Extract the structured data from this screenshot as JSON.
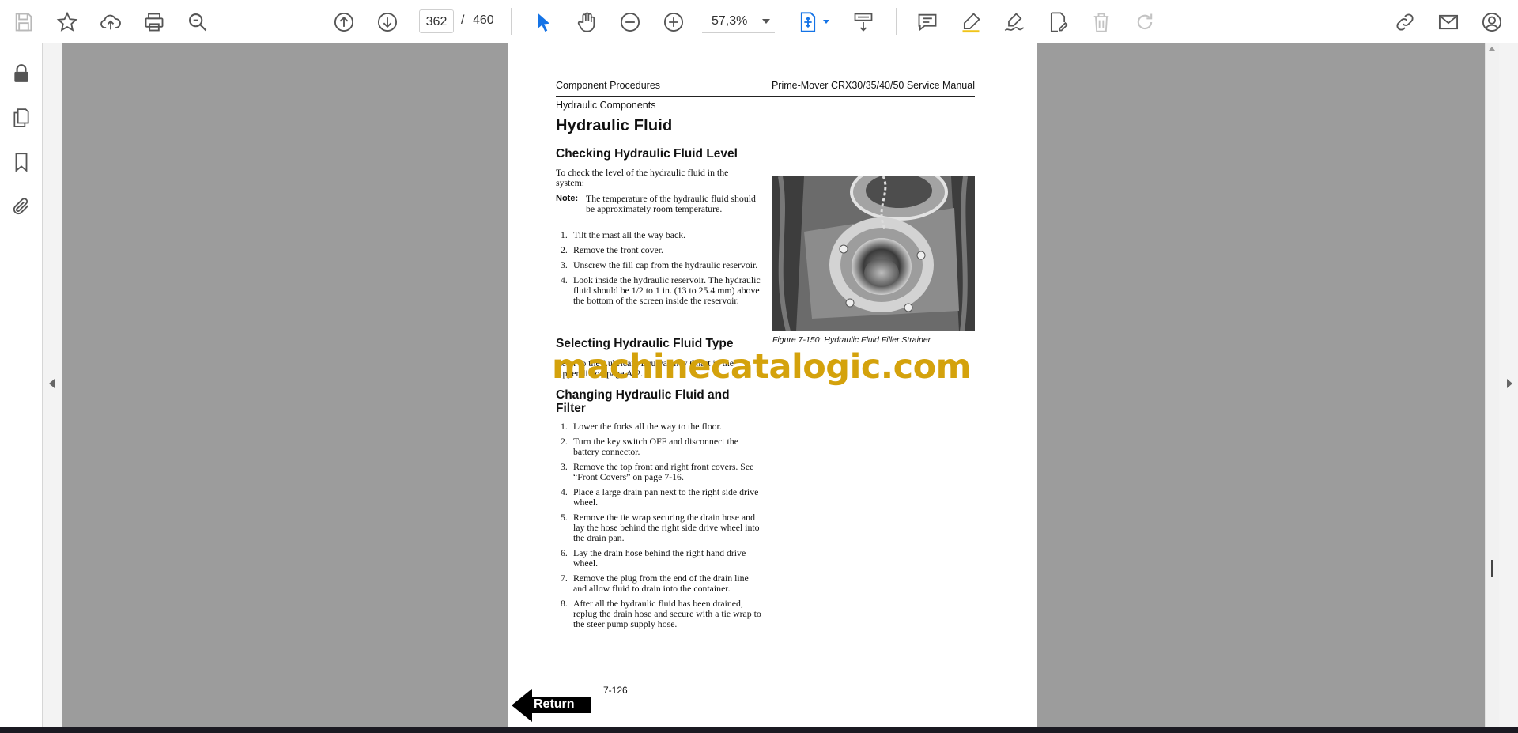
{
  "toolbar": {
    "current_page": "362",
    "page_separator": "/",
    "total_pages": "460",
    "zoom": "57,3%"
  },
  "document": {
    "header_left": "Component Procedures",
    "header_right": "Prime-Mover CRX30/35/40/50 Service Manual",
    "subheader": "Hydraulic Components",
    "title": "Hydraulic Fluid",
    "section1": {
      "heading": "Checking Hydraulic Fluid Level",
      "intro": "To check the level of the hydraulic fluid in the system:",
      "note_label": "Note:",
      "note_text": "The temperature of the hydraulic fluid should be approximately room temperature.",
      "steps": [
        "Tilt the mast all the way back.",
        "Remove the front cover.",
        "Unscrew the fill cap from the hydraulic reservoir.",
        "Look inside the hydraulic reservoir. The hydraulic fluid should be 1/2 to 1 in. (13 to 25.4 mm) above the bottom of the screen inside the reservoir."
      ]
    },
    "section2": {
      "heading": "Selecting Hydraulic Fluid Type",
      "text": "Refer to the Lubricant Equivalency Chart in the Appendix on page A-2."
    },
    "section3": {
      "heading": "Changing Hydraulic Fluid and Filter",
      "steps": [
        "Lower the forks all the way to the floor.",
        "Turn the key switch OFF and disconnect the battery connector.",
        "Remove the top front and right front covers. See “Front Covers” on page 7-16.",
        "Place a large drain pan next to the right side drive wheel.",
        "Remove the tie wrap securing the drain hose and lay the hose behind the right side drive wheel into the drain pan.",
        "Lay the drain hose behind the right hand drive wheel.",
        "Remove the plug from the end of the drain line and allow fluid to drain into the container.",
        "After all the hydraulic fluid has been drained, replug the drain hose and secure with a tie wrap to the steer pump supply hose."
      ]
    },
    "figure_caption": "Figure 7-150: Hydraulic Fluid Filler Strainer",
    "page_number": "7-126",
    "return_label": "Return",
    "watermark": "machinecatalogic.com"
  }
}
